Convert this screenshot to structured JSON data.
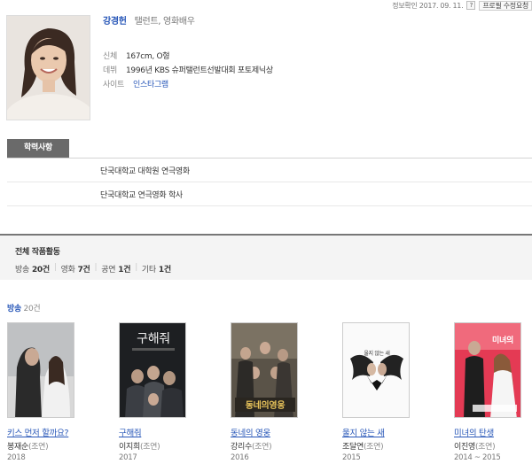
{
  "header": {
    "info_confirm": "정보확인 2017. 09. 11.",
    "help_icon": "?",
    "request_edit": "프로필 수정요청"
  },
  "person": {
    "name": "강경헌",
    "jobs": "탤런트, 영화배우",
    "rows": [
      {
        "key": "신체",
        "value": "167cm, O형"
      },
      {
        "key": "데뷔",
        "value": "1996년 KBS 슈퍼탤런트선발대회 포토제닉상"
      },
      {
        "key": "사이트",
        "value": "인스타그램"
      }
    ]
  },
  "education": {
    "tab_label": "학력사항",
    "items": [
      "단국대학교 대학원 연극영화",
      "단국대학교 연극영화 학사"
    ]
  },
  "works": {
    "title": "전체 작품활동",
    "stats": [
      {
        "label": "방송",
        "count": "20건"
      },
      {
        "label": "영화",
        "count": "7건"
      },
      {
        "label": "공연",
        "count": "1건"
      },
      {
        "label": "기타",
        "count": "1건"
      }
    ]
  },
  "broadcast": {
    "label": "방송",
    "count": "20건",
    "items": [
      {
        "title": "키스 먼저 할까요?",
        "actor": "봉재순",
        "role": "(조연)",
        "year": "2018"
      },
      {
        "title": "구해줘",
        "actor": "이지희",
        "role": "(조연)",
        "year": "2017"
      },
      {
        "title": "동네의 영웅",
        "actor": "강리수",
        "role": "(조연)",
        "year": "2016"
      },
      {
        "title": "울지 않는 새",
        "actor": "조달연",
        "role": "(조연)",
        "year": "2015"
      },
      {
        "title": "미녀의 탄생",
        "actor": "이진영",
        "role": "(조연)",
        "year": "2014 ~ 2015"
      }
    ]
  }
}
